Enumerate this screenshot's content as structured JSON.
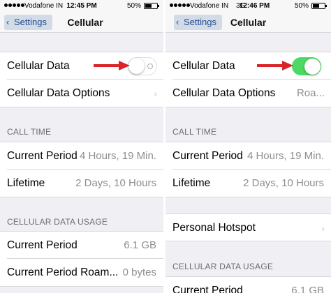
{
  "left": {
    "status": {
      "carrier": "Vodafone IN",
      "time": "12:45 PM",
      "battery": "50%",
      "battery_level": 0.5
    },
    "nav": {
      "back_label": "Settings",
      "title": "Cellular"
    },
    "cellular_data": {
      "label": "Cellular Data",
      "enabled": false
    },
    "cellular_data_options": {
      "label": "Cellular Data Options"
    },
    "call_time": {
      "header": "CALL TIME",
      "current_period": {
        "label": "Current Period",
        "value": "4 Hours, 19 Min."
      },
      "lifetime": {
        "label": "Lifetime",
        "value": "2 Days, 10 Hours"
      }
    },
    "usage": {
      "header": "CELLULAR DATA USAGE",
      "current_period": {
        "label": "Current Period",
        "value": "6.1 GB"
      },
      "current_period_roaming": {
        "label": "Current Period Roam...",
        "value": "0 bytes"
      }
    }
  },
  "right": {
    "status": {
      "carrier": "Vodafone IN",
      "network": "3G",
      "time": "12:46 PM",
      "battery": "50%",
      "battery_level": 0.5
    },
    "nav": {
      "back_label": "Settings",
      "title": "Cellular"
    },
    "cellular_data": {
      "label": "Cellular Data",
      "enabled": true
    },
    "cellular_data_options": {
      "label": "Cellular Data Options",
      "value": "Roa..."
    },
    "call_time": {
      "header": "CALL TIME",
      "current_period": {
        "label": "Current Period",
        "value": "4 Hours, 19 Min."
      },
      "lifetime": {
        "label": "Lifetime",
        "value": "2 Days, 10 Hours"
      }
    },
    "personal_hotspot": {
      "label": "Personal Hotspot"
    },
    "usage": {
      "header": "CELLULAR DATA USAGE",
      "current_period": {
        "label": "Current Period",
        "value": "6.1 GB"
      }
    }
  },
  "colors": {
    "toggle_on": "#4cd964",
    "arrow": "#d9252a",
    "back_button_text": "#1f4d8f"
  },
  "icons": [
    "chevron-left-icon",
    "chevron-right-icon",
    "red-arrow-icon",
    "battery-icon",
    "signal-icon"
  ]
}
